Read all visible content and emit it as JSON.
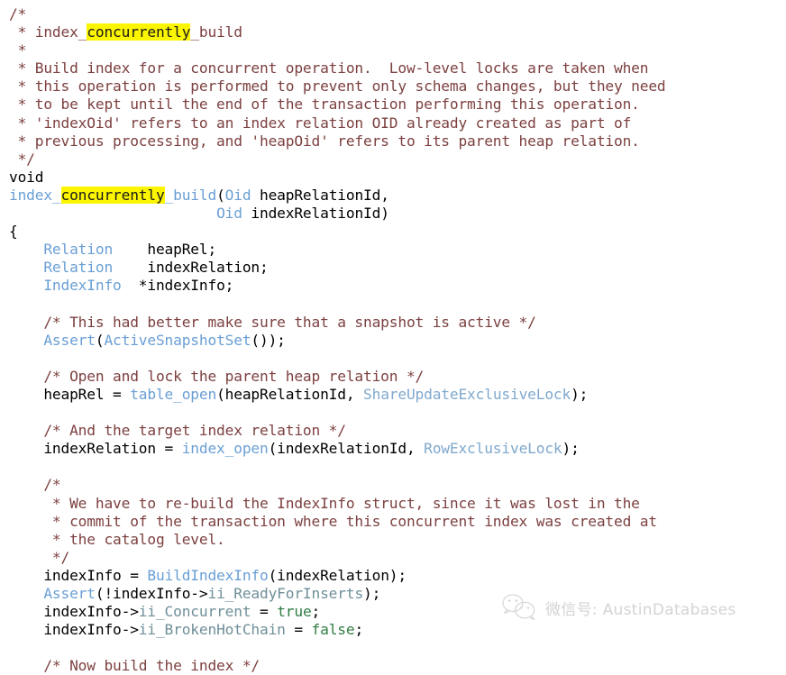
{
  "meta": {
    "kind": "source-code-viewer",
    "language": "C",
    "background_color": "#ffffff",
    "highlight_color": "#fcf500",
    "comment_color": "#7d4040",
    "identifier_blue": "#6a9fd4",
    "member_color": "#6f8f99",
    "bool_color": "#2f7d43",
    "watermark_color": "#b9b9b9"
  },
  "highlight_term": "concurrently",
  "code": {
    "lines": [
      {
        "id": 1,
        "indent": 0,
        "tokens": [
          {
            "t": "/*",
            "c": "comment"
          }
        ]
      },
      {
        "id": 2,
        "indent": 0,
        "tokens": [
          {
            "t": " * index_",
            "c": "comment"
          },
          {
            "t": "concurrently",
            "c": "hl"
          },
          {
            "t": "_build",
            "c": "comment"
          }
        ]
      },
      {
        "id": 3,
        "indent": 0,
        "tokens": [
          {
            "t": " *",
            "c": "comment"
          }
        ]
      },
      {
        "id": 4,
        "indent": 0,
        "tokens": [
          {
            "t": " * Build index for a concurrent operation.  Low-level locks are taken when",
            "c": "comment"
          }
        ]
      },
      {
        "id": 5,
        "indent": 0,
        "tokens": [
          {
            "t": " * this operation is performed to prevent only schema changes, but they need",
            "c": "comment"
          }
        ]
      },
      {
        "id": 6,
        "indent": 0,
        "tokens": [
          {
            "t": " * to be kept until the end of the transaction performing this operation.",
            "c": "comment"
          }
        ]
      },
      {
        "id": 7,
        "indent": 0,
        "tokens": [
          {
            "t": " * 'indexOid' refers to an index relation OID already created as part of",
            "c": "comment"
          }
        ]
      },
      {
        "id": 8,
        "indent": 0,
        "tokens": [
          {
            "t": " * previous processing, and 'heapOid' refers to its parent heap relation.",
            "c": "comment"
          }
        ]
      },
      {
        "id": 9,
        "indent": 0,
        "tokens": [
          {
            "t": " */",
            "c": "comment"
          }
        ]
      },
      {
        "id": 10,
        "indent": 0,
        "tokens": [
          {
            "t": "void",
            "c": "plain"
          }
        ]
      },
      {
        "id": 11,
        "indent": 0,
        "tokens": [
          {
            "t": "index_",
            "c": "func"
          },
          {
            "t": "concurrently",
            "c": "hl-code"
          },
          {
            "t": "_build",
            "c": "func"
          },
          {
            "t": "(",
            "c": "punct"
          },
          {
            "t": "Oid",
            "c": "type"
          },
          {
            "t": " heapRelationId,",
            "c": "plain"
          }
        ]
      },
      {
        "id": 12,
        "indent": 0,
        "tokens": [
          {
            "t": "                        ",
            "c": "plain"
          },
          {
            "t": "Oid",
            "c": "type"
          },
          {
            "t": " indexRelationId)",
            "c": "plain"
          }
        ]
      },
      {
        "id": 13,
        "indent": 0,
        "tokens": [
          {
            "t": "{",
            "c": "plain"
          }
        ]
      },
      {
        "id": 14,
        "indent": 0,
        "tokens": [
          {
            "t": "    ",
            "c": "plain"
          },
          {
            "t": "Relation",
            "c": "type"
          },
          {
            "t": "    heapRel;",
            "c": "plain"
          }
        ]
      },
      {
        "id": 15,
        "indent": 0,
        "tokens": [
          {
            "t": "    ",
            "c": "plain"
          },
          {
            "t": "Relation",
            "c": "type"
          },
          {
            "t": "    indexRelation;",
            "c": "plain"
          }
        ]
      },
      {
        "id": 16,
        "indent": 0,
        "tokens": [
          {
            "t": "    ",
            "c": "plain"
          },
          {
            "t": "IndexInfo",
            "c": "type"
          },
          {
            "t": "  *indexInfo;",
            "c": "plain"
          }
        ]
      },
      {
        "id": 17,
        "indent": 0,
        "tokens": []
      },
      {
        "id": 18,
        "indent": 0,
        "tokens": [
          {
            "t": "    /* This had better make sure that a snapshot is active */",
            "c": "comment"
          }
        ]
      },
      {
        "id": 19,
        "indent": 0,
        "tokens": [
          {
            "t": "    ",
            "c": "plain"
          },
          {
            "t": "Assert",
            "c": "func"
          },
          {
            "t": "(",
            "c": "punct"
          },
          {
            "t": "ActiveSnapshotSet",
            "c": "func"
          },
          {
            "t": "());",
            "c": "punct"
          }
        ]
      },
      {
        "id": 20,
        "indent": 0,
        "tokens": []
      },
      {
        "id": 21,
        "indent": 0,
        "tokens": [
          {
            "t": "    /* Open and lock the parent heap relation */",
            "c": "comment"
          }
        ]
      },
      {
        "id": 22,
        "indent": 0,
        "tokens": [
          {
            "t": "    heapRel = ",
            "c": "plain"
          },
          {
            "t": "table_open",
            "c": "func"
          },
          {
            "t": "(heapRelationId, ",
            "c": "plain"
          },
          {
            "t": "ShareUpdateExclusiveLock",
            "c": "const"
          },
          {
            "t": ");",
            "c": "plain"
          }
        ]
      },
      {
        "id": 23,
        "indent": 0,
        "tokens": []
      },
      {
        "id": 24,
        "indent": 0,
        "tokens": [
          {
            "t": "    /* And the target index relation */",
            "c": "comment"
          }
        ]
      },
      {
        "id": 25,
        "indent": 0,
        "tokens": [
          {
            "t": "    indexRelation = ",
            "c": "plain"
          },
          {
            "t": "index_open",
            "c": "func"
          },
          {
            "t": "(indexRelationId, ",
            "c": "plain"
          },
          {
            "t": "RowExclusiveLock",
            "c": "const"
          },
          {
            "t": ");",
            "c": "plain"
          }
        ]
      },
      {
        "id": 26,
        "indent": 0,
        "tokens": []
      },
      {
        "id": 27,
        "indent": 0,
        "tokens": [
          {
            "t": "    /*",
            "c": "comment"
          }
        ]
      },
      {
        "id": 28,
        "indent": 0,
        "tokens": [
          {
            "t": "     * We have to re-build the IndexInfo struct, since it was lost in the",
            "c": "comment"
          }
        ]
      },
      {
        "id": 29,
        "indent": 0,
        "tokens": [
          {
            "t": "     * commit of the transaction where this concurrent index was created at",
            "c": "comment"
          }
        ]
      },
      {
        "id": 30,
        "indent": 0,
        "tokens": [
          {
            "t": "     * the catalog level.",
            "c": "comment"
          }
        ]
      },
      {
        "id": 31,
        "indent": 0,
        "tokens": [
          {
            "t": "     */",
            "c": "comment"
          }
        ]
      },
      {
        "id": 32,
        "indent": 0,
        "tokens": [
          {
            "t": "    indexInfo = ",
            "c": "plain"
          },
          {
            "t": "BuildIndexInfo",
            "c": "func"
          },
          {
            "t": "(indexRelation);",
            "c": "plain"
          }
        ]
      },
      {
        "id": 33,
        "indent": 0,
        "tokens": [
          {
            "t": "    ",
            "c": "plain"
          },
          {
            "t": "Assert",
            "c": "func"
          },
          {
            "t": "(!indexInfo->",
            "c": "plain"
          },
          {
            "t": "ii_ReadyForInserts",
            "c": "member"
          },
          {
            "t": ");",
            "c": "plain"
          }
        ]
      },
      {
        "id": 34,
        "indent": 0,
        "tokens": [
          {
            "t": "    indexInfo->",
            "c": "plain"
          },
          {
            "t": "ii_Concurrent",
            "c": "member"
          },
          {
            "t": " = ",
            "c": "plain"
          },
          {
            "t": "true",
            "c": "bool"
          },
          {
            "t": ";",
            "c": "plain"
          }
        ]
      },
      {
        "id": 35,
        "indent": 0,
        "tokens": [
          {
            "t": "    indexInfo->",
            "c": "plain"
          },
          {
            "t": "ii_BrokenHotChain",
            "c": "member"
          },
          {
            "t": " = ",
            "c": "plain"
          },
          {
            "t": "false",
            "c": "bool"
          },
          {
            "t": ";",
            "c": "plain"
          }
        ]
      },
      {
        "id": 36,
        "indent": 0,
        "tokens": []
      },
      {
        "id": 37,
        "indent": 0,
        "tokens": [
          {
            "t": "    /* Now build the index */",
            "c": "comment"
          }
        ]
      }
    ]
  },
  "watermark": {
    "icon": "wechat-icon",
    "label": "微信号: AustinDatabases"
  }
}
